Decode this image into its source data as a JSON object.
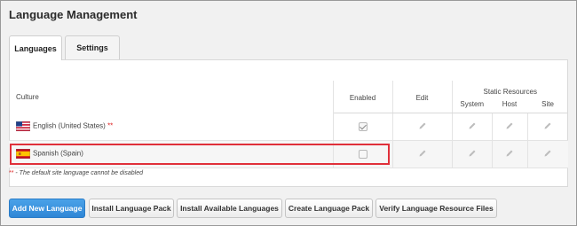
{
  "page": {
    "title": "Language Management"
  },
  "tabs": [
    {
      "label": "Languages",
      "active": true
    },
    {
      "label": "Settings",
      "active": false
    }
  ],
  "table": {
    "group_header": "Static Resources",
    "headers": {
      "culture": "Culture",
      "enabled": "Enabled",
      "edit": "Edit",
      "system": "System",
      "host": "Host",
      "site": "Site"
    },
    "rows": [
      {
        "culture": "English (United States)",
        "required_marker": "**",
        "flag": "us-flag-icon",
        "enabled": true,
        "highlighted": false
      },
      {
        "culture": "Spanish (Spain)",
        "required_marker": "",
        "flag": "spain-flag-icon",
        "enabled": false,
        "highlighted": true
      }
    ]
  },
  "footnote": {
    "marker": "**",
    "text": " - The default site language cannot be disabled"
  },
  "buttons": {
    "add_new_language": "Add New Language",
    "install_language_pack": "Install Language Pack",
    "install_available_languages": "Install Available Languages",
    "create_language_pack": "Create Language Pack",
    "verify_language_resource_files": "Verify Language Resource Files"
  },
  "colors": {
    "primary_button": "#2f86d6",
    "highlight_border": "#e0303a",
    "required_marker": "#dd2222"
  }
}
